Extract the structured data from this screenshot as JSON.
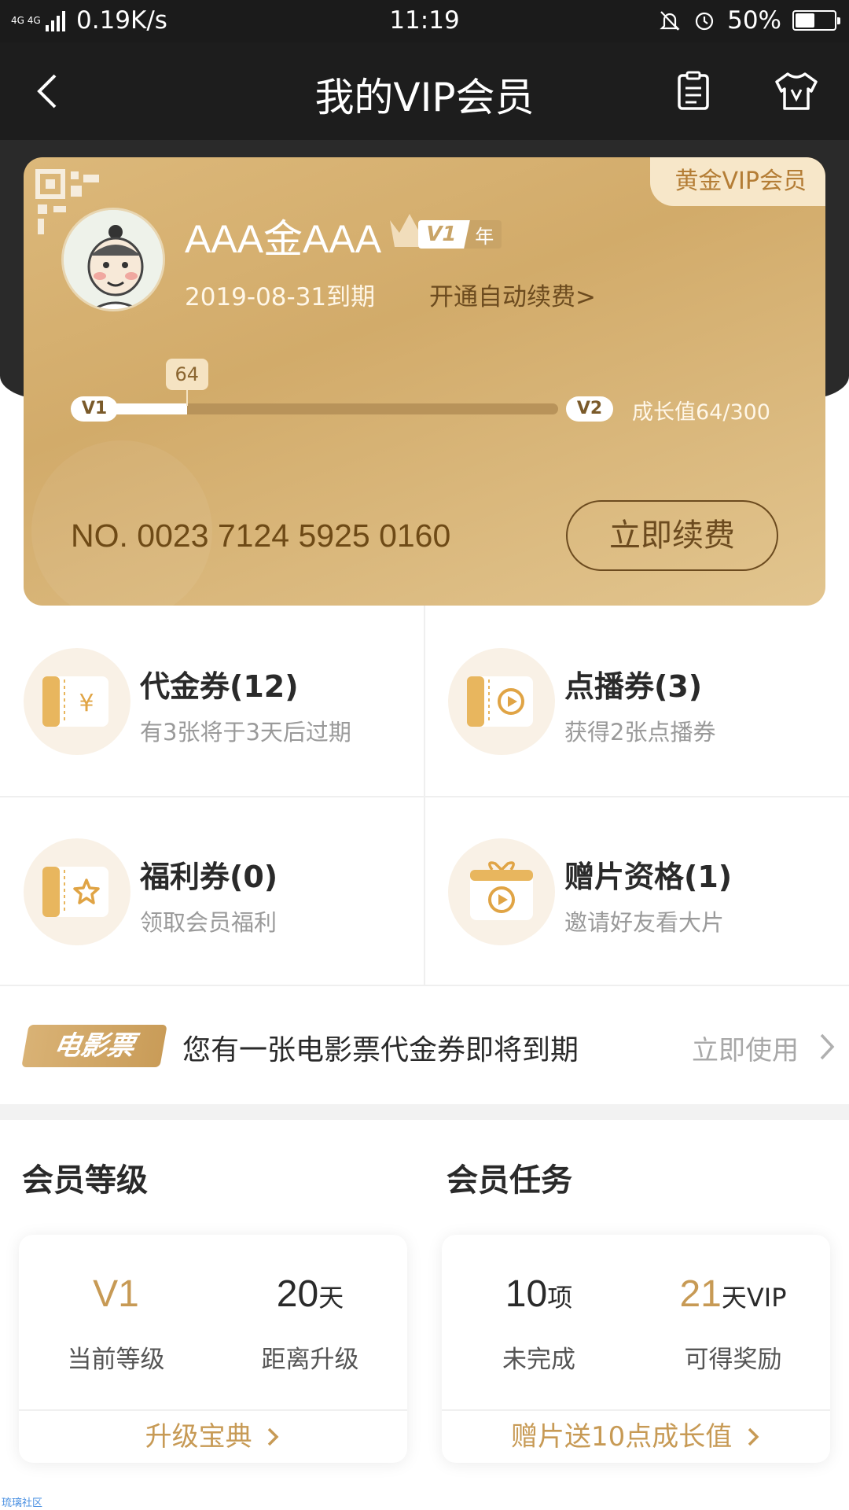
{
  "status_bar": {
    "network": "4G 4G",
    "speed": "0.19K/s",
    "time": "11:19",
    "battery": "50%",
    "battery_level": 0.5
  },
  "nav": {
    "title": "我的VIP会员",
    "back_icon": "chevron-left-icon",
    "list_icon": "clipboard-icon",
    "shirt_icon": "vip-shirt-icon"
  },
  "card": {
    "badge": "黄金VIP会员",
    "username": "AAA金AAA",
    "level": "V1",
    "term": "年",
    "expire": "2019-08-31到期",
    "auto_renew": "开通自动续费>",
    "progress_start": "V1",
    "progress_end": "V2",
    "progress_value": "64",
    "progress_fraction": 0.213,
    "growth": "成长值64/300",
    "card_no": "NO. 0023 7124 5925 0160",
    "renew_button": "立即续费"
  },
  "coupons": [
    {
      "title": "代金券(12)",
      "sub": "有3张将于3天后过期",
      "icon": "yuan-ticket-icon"
    },
    {
      "title": "点播券(3)",
      "sub": "获得2张点播券",
      "icon": "play-ticket-icon"
    },
    {
      "title": "福利券(0)",
      "sub": "领取会员福利",
      "icon": "star-ticket-icon"
    },
    {
      "title": "赠片资格(1)",
      "sub": "邀请好友看大片",
      "icon": "gift-play-icon"
    }
  ],
  "notice": {
    "tag": "电影票",
    "text": "您有一张电影票代金券即将到期",
    "link": "立即使用"
  },
  "level_panel": {
    "title": "会员等级",
    "stat1_value": "V1",
    "stat1_unit": "",
    "stat1_label": "当前等级",
    "stat2_value": "20",
    "stat2_unit": "天",
    "stat2_label": "距离升级",
    "link": "升级宝典"
  },
  "task_panel": {
    "title": "会员任务",
    "stat1_value": "10",
    "stat1_unit": "项",
    "stat1_label": "未完成",
    "stat2_value": "21",
    "stat2_unit": "天VIP",
    "stat2_label": "可得奖励",
    "link": "赠片送10点成长值"
  },
  "watermark": "琉璃社区",
  "colors": {
    "gold": "#c79a55",
    "card_gold": "#d2ab6a",
    "dark_header": "#1d1d1d"
  }
}
